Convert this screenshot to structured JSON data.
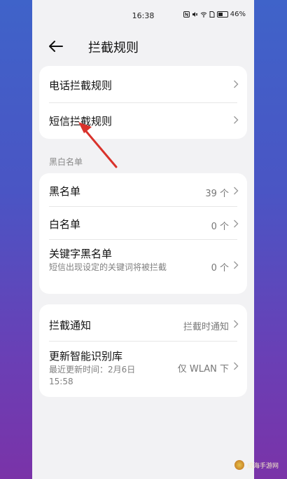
{
  "status_bar": {
    "time": "16:38",
    "battery": "46%",
    "icons": [
      "nfc-icon",
      "mute-icon",
      "wifi-icon",
      "sim-icon",
      "battery-icon"
    ]
  },
  "header": {
    "title": "拦截规则"
  },
  "cards": {
    "rules": [
      {
        "label": "电话拦截规则"
      },
      {
        "label": "短信拦截规则"
      }
    ],
    "section_title": "黑白名单",
    "lists": [
      {
        "label": "黑名单",
        "value": "39 个"
      },
      {
        "label": "白名单",
        "value": "0 个"
      },
      {
        "label": "关键字黑名单",
        "sub": "短信出现设定的关键词将被拦截",
        "value": "0 个"
      }
    ],
    "settings": [
      {
        "label": "拦截通知",
        "value": "拦截时通知"
      },
      {
        "label": "更新智能识别库",
        "sub": "最近更新时间：2月6日 15:58",
        "value": "仅 WLAN 下"
      }
    ]
  },
  "annotation": {
    "color": "#d9322b"
  },
  "watermark": {
    "text": "成海手游网"
  }
}
